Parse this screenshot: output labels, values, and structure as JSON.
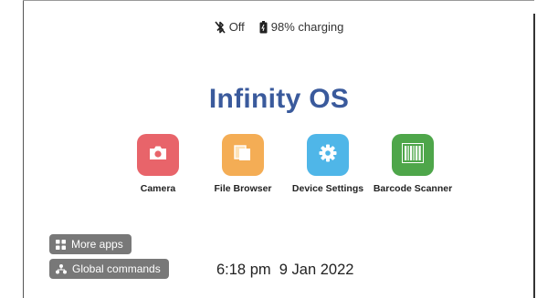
{
  "status_bar": {
    "bluetooth_icon": "bluetooth-off-icon",
    "bluetooth_label": "Off",
    "battery_icon": "battery-icon",
    "battery_label": "98% charging"
  },
  "home": {
    "title": "Infinity OS"
  },
  "apps": [
    {
      "label": "Camera",
      "icon": "camera-icon",
      "color": "#e8646a"
    },
    {
      "label": "File Browser",
      "icon": "folder-icon",
      "color": "#f4ad55"
    },
    {
      "label": "Device Settings",
      "icon": "gear-icon",
      "color": "#4fb6e8"
    },
    {
      "label": "Barcode Scanner",
      "icon": "barcode-icon",
      "color": "#4ea64a"
    }
  ],
  "buttons": {
    "more_apps": "More apps",
    "global_commands": "Global commands"
  },
  "clock": {
    "time": "6:18 pm",
    "date": "9 Jan 2022"
  },
  "colors": {
    "title": "#3a5a9c",
    "pill_background": "#787878"
  }
}
